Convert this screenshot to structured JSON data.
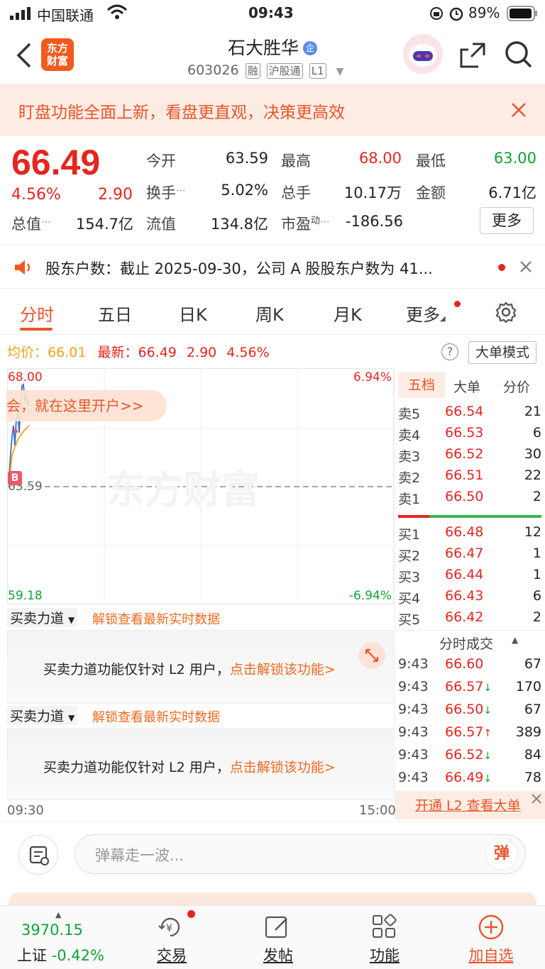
{
  "status_bar": {
    "carrier": "中国联通",
    "time": "09:43",
    "battery": "89%"
  },
  "header": {
    "logo_text_1": "东方",
    "logo_text_2": "财富",
    "stock_name": "石大胜华",
    "qiye_badge": "企",
    "code": "603026",
    "tag_rong": "融",
    "tag_hgt": "沪股通",
    "tag_level": "L1"
  },
  "banner": {
    "text": "盯盘功能全面上新，看盘更直观，决策更高效"
  },
  "quote": {
    "price": "66.49",
    "change_pct": "4.56%",
    "change": "2.90",
    "open_label": "今开",
    "open": "63.59",
    "high_label": "最高",
    "high": "68.00",
    "low_label": "最低",
    "low": "63.00",
    "turnover_label": "换手",
    "turnover": "5.02%",
    "volume_label": "总手",
    "volume": "10.17万",
    "amount_label": "金额",
    "amount": "6.71亿",
    "mktcap_label": "总值",
    "mktcap": "154.7亿",
    "float_label": "流值",
    "float": "134.8亿",
    "pe_label": "市盈",
    "pe_sup": "动",
    "pe": "-186.56",
    "more": "更多"
  },
  "notice": {
    "text": "股东户数：截止 2025-09-30，公司 A 股股东户数为 41..."
  },
  "tabs": [
    "分时",
    "五日",
    "日K",
    "周K",
    "月K",
    "更多"
  ],
  "info": {
    "avg_label": "均价：",
    "avg": "66.01",
    "latest_label": "最新：",
    "latest": "66.49",
    "chg": "2.90",
    "pct": "4.56%",
    "big_order_mode": "大单模式"
  },
  "chart": {
    "top_price": "68.00",
    "bottom_price": "59.18",
    "top_pct": "6.94%",
    "bottom_pct": "-6.94%",
    "base_price": "63.59",
    "open_time": "09:30",
    "close_time": "15:00",
    "watermark": "东方财富",
    "promo": "会，就在这里开户>>",
    "b_marker": "B"
  },
  "order_book": {
    "tabs": [
      "五档",
      "大单",
      "分价"
    ],
    "asks": [
      {
        "label": "卖5",
        "price": "66.54",
        "vol": "21"
      },
      {
        "label": "卖4",
        "price": "66.53",
        "vol": "6"
      },
      {
        "label": "卖3",
        "price": "66.52",
        "vol": "30"
      },
      {
        "label": "卖2",
        "price": "66.51",
        "vol": "22"
      },
      {
        "label": "卖1",
        "price": "66.50",
        "vol": "2"
      }
    ],
    "bids": [
      {
        "label": "买1",
        "price": "66.48",
        "vol": "12"
      },
      {
        "label": "买2",
        "price": "66.47",
        "vol": "1"
      },
      {
        "label": "买3",
        "price": "66.44",
        "vol": "1"
      },
      {
        "label": "买4",
        "price": "66.43",
        "vol": "6"
      },
      {
        "label": "买5",
        "price": "66.42",
        "vol": "2"
      }
    ]
  },
  "ticks": {
    "title": "分时成交",
    "rows": [
      {
        "time": "9:43",
        "price": "66.60",
        "arrow": "",
        "vol": "67"
      },
      {
        "time": "9:43",
        "price": "66.57",
        "arrow": "↓",
        "vol": "170"
      },
      {
        "time": "9:43",
        "price": "66.50",
        "arrow": "↓",
        "vol": "67"
      },
      {
        "time": "9:43",
        "price": "66.57",
        "arrow": "↑",
        "vol": "389"
      },
      {
        "time": "9:43",
        "price": "66.52",
        "arrow": "↓",
        "vol": "84"
      },
      {
        "time": "9:43",
        "price": "66.49",
        "arrow": "↓",
        "vol": "78"
      }
    ],
    "l2_link": "开通 L2 查看大单"
  },
  "sub1": {
    "select": "买卖力道",
    "unlock": "解锁查看最新实时数据",
    "msg": "买卖力道功能仅针对 L2 用户，",
    "link": "点击解锁该功能>"
  },
  "sub2": {
    "select": "买卖力道",
    "unlock": "解锁查看最新实时数据",
    "msg": "买卖力道功能仅针对 L2 用户，",
    "link": "点击解锁该功能>"
  },
  "comment": {
    "placeholder": "弹幕走一波...",
    "danmu_btn": "弹"
  },
  "nav": {
    "index_value": "3970.15",
    "index_name": "上证",
    "index_change": "-0.42%",
    "trade": "交易",
    "post": "发帖",
    "func": "功能",
    "add": "加自选"
  }
}
